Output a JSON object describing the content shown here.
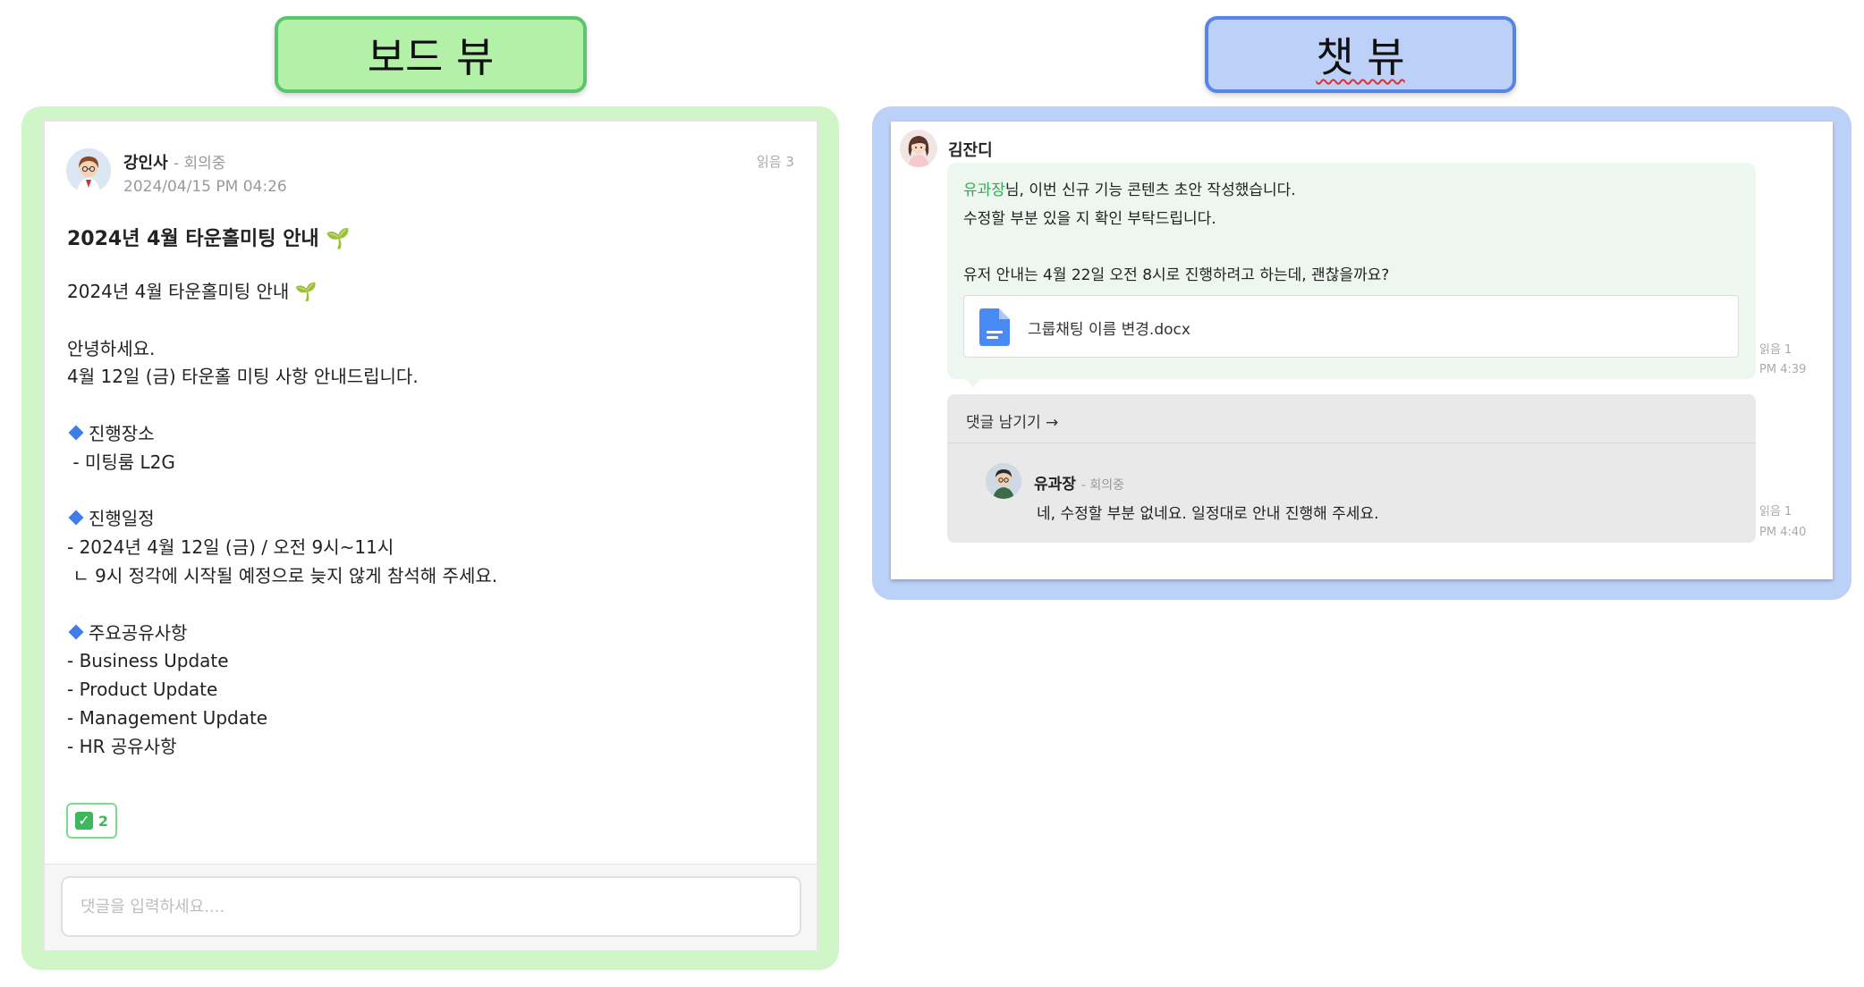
{
  "labels": {
    "board_view": "보드 뷰",
    "chat_view": "챗 뷰"
  },
  "board": {
    "author": "강인사",
    "author_status": "- 회의중",
    "date": "2024/04/15 PM 04:26",
    "read_count": "읽음 3",
    "title": "2024년 4월 타운홀미팅 안내 🌱",
    "body_lines": [
      "2024년 4월 타운홀미팅 안내 🌱",
      "",
      "안녕하세요.",
      "4월 12일 (금) 타운홀 미팅 사항 안내드립니다.",
      "",
      "진행장소",
      " - 미팅룸 L2G",
      "",
      "진행일정",
      "- 2024년 4월 12일 (금) / 오전 9시~11시",
      " ㄴ 9시 정각에 시작될 예정으로 늦지 않게 참석해 주세요.",
      "",
      "주요공유사항",
      "- Business Update",
      "- Product Update",
      "- Management Update",
      "- HR 공유사항"
    ],
    "reaction_icon": "✓",
    "reaction_count": "2",
    "comment_placeholder": "댓글을 입력하세요...."
  },
  "chat": {
    "author": "김잔디",
    "mention": "유과장",
    "line1_rest": "님, 이번 신규 기능 콘텐츠 초안 작성했습니다.",
    "line2": "수정할 부분 있을 지 확인 부탁드립니다.",
    "line3": "",
    "line4": "유저 안내는 4월 22일 오전 8시로 진행하려고 하는데, 괜찮을까요?",
    "file_name": "그룹채팅 이름 변경.docx",
    "msg_read": "읽음 1",
    "msg_time": "PM 4:39",
    "comment_link": "댓글 남기기 →",
    "reply_author": "유과장",
    "reply_status": "- 회의중",
    "reply_text": "네, 수정할 부분 없네요. 일정대로 안내 진행해 주세요.",
    "reply_read": "읽음 1",
    "reply_time": "PM 4:40"
  },
  "colors": {
    "board_tab_bg": "#b3f0a8",
    "board_tab_border": "#5cc56c",
    "board_frame": "#d0f5c6",
    "chat_tab_bg": "#bdd0f8",
    "chat_tab_border": "#5684e8",
    "chat_frame": "#bcd1f8",
    "mention": "#3aa65a",
    "diamond": "#3f7ee8",
    "file_icon": "#4a8af4"
  },
  "icons": {
    "section_bullet": "diamond-icon",
    "file": "docx-file-icon",
    "reaction": "check-mark-icon"
  }
}
